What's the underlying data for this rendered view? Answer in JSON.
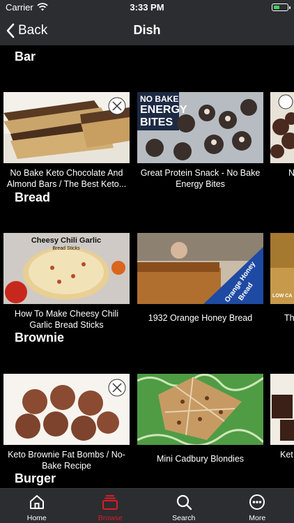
{
  "status": {
    "carrier": "Carrier",
    "time": "3:33 PM"
  },
  "nav": {
    "back_label": "Back",
    "title": "Dish"
  },
  "sections": [
    {
      "title": "Bar",
      "cards": [
        {
          "title": "No Bake Keto Chocolate And Almond Bars / The Best Keto..."
        },
        {
          "title": "Great Protein Snack - No Bake Energy Bites"
        },
        {
          "title": "N"
        }
      ]
    },
    {
      "title": "Bread",
      "cards": [
        {
          "title": "How To Make Cheesy Chili Garlic Bread Sticks"
        },
        {
          "title": "1932 Orange Honey Bread"
        },
        {
          "title": "Th"
        }
      ]
    },
    {
      "title": "Brownie",
      "cards": [
        {
          "title": "Keto Brownie Fat Bombs / No-Bake Recipe"
        },
        {
          "title": "Mini Cadbury Blondies"
        },
        {
          "title": "Ket"
        }
      ]
    },
    {
      "title": "Burger",
      "cards": []
    }
  ],
  "thumbnails": {
    "energy_bites_text": "NO BAKE ENERGY BITES",
    "cheesy_text": "Cheesy Chili Garlic",
    "cheesy_sub": "Bread Sticks",
    "honey_text": "Orange Honey Bread",
    "low_carb_text": "LOW CA"
  },
  "tabs": [
    {
      "label": "Home",
      "icon": "home-icon"
    },
    {
      "label": "Browse",
      "icon": "browse-icon",
      "active": true
    },
    {
      "label": "Search",
      "icon": "search-icon"
    },
    {
      "label": "More",
      "icon": "more-icon"
    }
  ],
  "colors": {
    "bar_bg": "#2b2d31",
    "accent": "#e01b24",
    "background": "#000000"
  }
}
